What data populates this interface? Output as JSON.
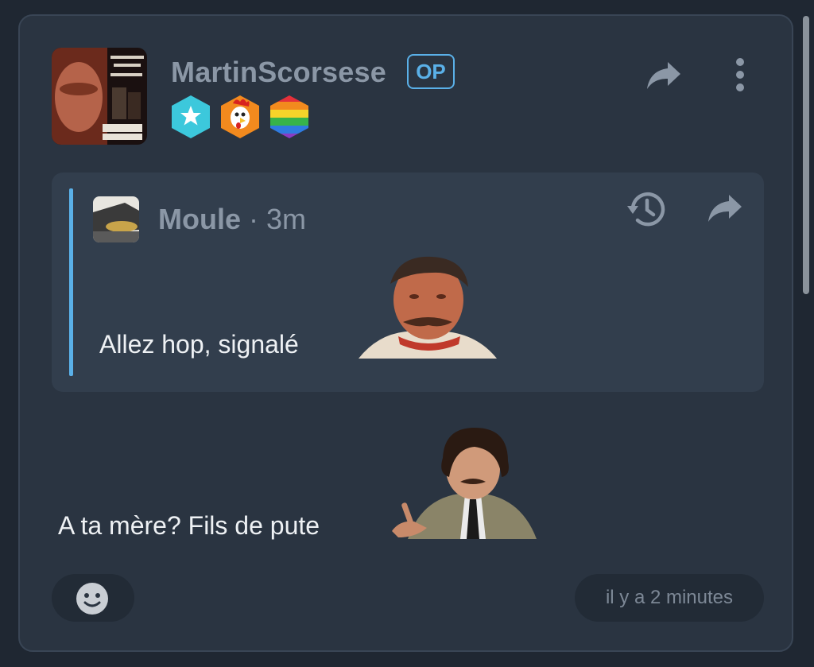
{
  "post": {
    "username": "MartinScorsese",
    "op_label": "OP",
    "avatar": "killers-of-the-flower-moon-poster",
    "badges": [
      "star-badge-icon",
      "rooster-badge-icon",
      "rainbow-badge-icon"
    ],
    "share_icon": "share-icon",
    "menu_icon": "more-vertical-icon",
    "message": "A ta mère? Fils de pute",
    "sticker": "man-pointing-sticker",
    "timestamp": "il y a 2 minutes",
    "reaction_icon": "add-reaction-icon"
  },
  "quote": {
    "username": "Moule",
    "separator": "·",
    "time": "3m",
    "history_icon": "history-icon",
    "share_icon": "share-icon",
    "message": "Allez hop, signalé",
    "sticker": "old-man-sticker"
  },
  "colors": {
    "background": "#1f2732",
    "card": "#2a3441",
    "quote_bg": "#323e4d",
    "accent": "#5ab0e8",
    "username": "#8b97a6",
    "text": "#eef1f4"
  }
}
